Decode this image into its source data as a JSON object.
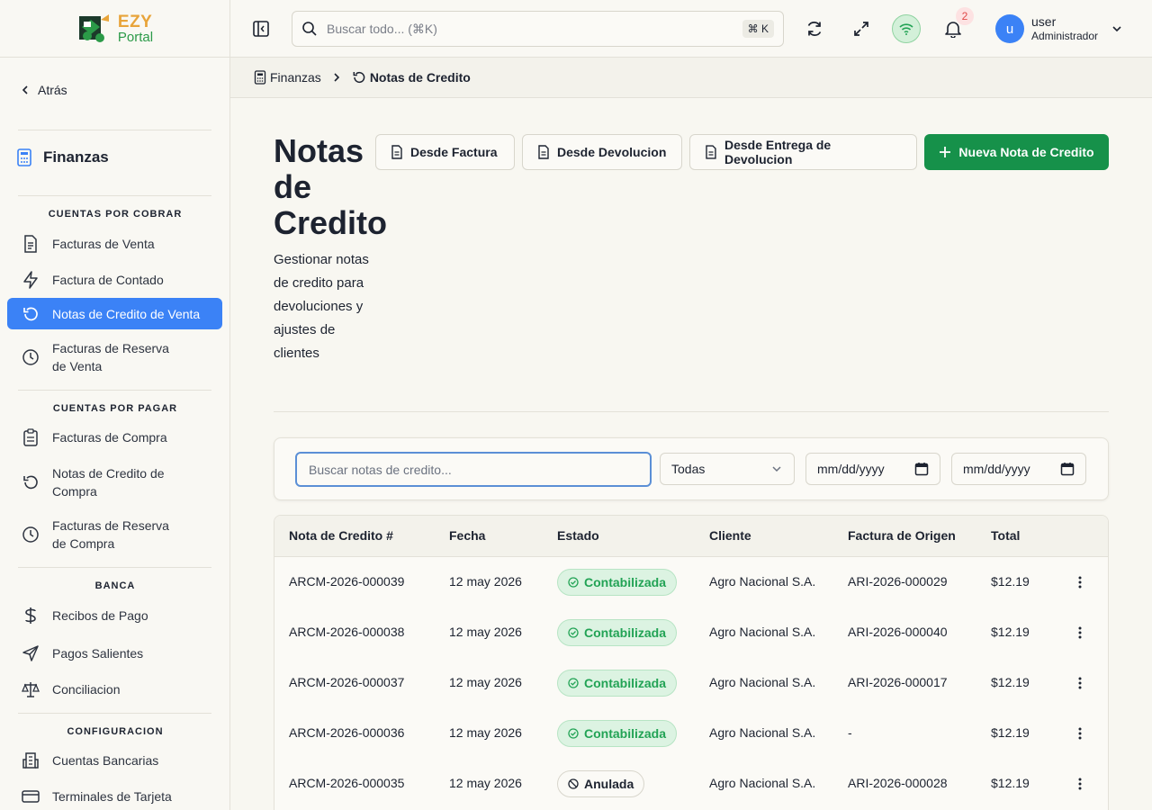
{
  "logo": {
    "line1": "EZY",
    "line2": "Portal"
  },
  "sidebar": {
    "back_label": "Atrás",
    "module_title": "Finanzas",
    "sections": [
      {
        "title": "CUENTAS POR COBRAR",
        "items": [
          "Facturas de Venta",
          "Factura de Contado",
          "Notas de Credito de Venta",
          "Facturas de Reserva de Venta"
        ]
      },
      {
        "title": "CUENTAS POR PAGAR",
        "items": [
          "Facturas de Compra",
          "Notas de Credito de Compra",
          "Facturas de Reserva de Compra"
        ]
      },
      {
        "title": "BANCA",
        "items": [
          "Recibos de Pago",
          "Pagos Salientes",
          "Conciliacion"
        ]
      },
      {
        "title": "CONFIGURACION",
        "items": [
          "Cuentas Bancarias",
          "Terminales de Tarjeta"
        ]
      }
    ],
    "item_labels": {
      "facturas_venta": "Facturas de Venta",
      "factura_contado": "Factura de Contado",
      "notas_credito_venta": "Notas de Credito de Venta",
      "facturas_reserva_venta": "Facturas de Reserva de Venta",
      "facturas_compra": "Facturas de Compra",
      "notas_credito_compra": "Notas de Credito de Compra",
      "facturas_reserva_compra": "Facturas de Reserva de Compra",
      "recibos_pago": "Recibos de Pago",
      "pagos_salientes": "Pagos Salientes",
      "conciliacion": "Conciliacion",
      "cuentas_bancarias": "Cuentas Bancarias",
      "terminales_tarjeta": "Terminales de Tarjeta"
    },
    "active_item": "Notas de Credito de Venta"
  },
  "topbar": {
    "search_placeholder": "Buscar todo... (⌘K)",
    "search_shortcut": "⌘ K",
    "notification_count": "2",
    "user_initial": "u",
    "user_name": "user",
    "user_role": "Administrador"
  },
  "breadcrumb": {
    "parent": "Finanzas",
    "current": "Notas de Credito"
  },
  "page": {
    "title": "Notas de Credito",
    "subtitle": "Gestionar notas de credito para devoluciones y ajustes de clientes",
    "actions": {
      "from_invoice": "Desde Factura",
      "from_return": "Desde Devolucion",
      "from_return_delivery": "Desde Entrega de Devolucion",
      "new": "Nueva Nota de Credito"
    }
  },
  "filters": {
    "search_placeholder": "Buscar notas de credito...",
    "status_value": "Todas",
    "date_from": "mm/dd/yyyy",
    "date_to": "mm/dd/yyyy"
  },
  "table": {
    "columns": {
      "number": "Nota de Credito #",
      "date": "Fecha",
      "status": "Estado",
      "customer": "Cliente",
      "source_invoice": "Factura de Origen",
      "total": "Total"
    },
    "rows": [
      {
        "number": "ARCM-2026-000039",
        "date": "12 may 2026",
        "status": "Contabilizada",
        "customer": "Agro Nacional S.A.",
        "source_invoice": "ARI-2026-000029",
        "total": "$12.19"
      },
      {
        "number": "ARCM-2026-000038",
        "date": "12 may 2026",
        "status": "Contabilizada",
        "customer": "Agro Nacional S.A.",
        "source_invoice": "ARI-2026-000040",
        "total": "$12.19"
      },
      {
        "number": "ARCM-2026-000037",
        "date": "12 may 2026",
        "status": "Contabilizada",
        "customer": "Agro Nacional S.A.",
        "source_invoice": "ARI-2026-000017",
        "total": "$12.19"
      },
      {
        "number": "ARCM-2026-000036",
        "date": "12 may 2026",
        "status": "Contabilizada",
        "customer": "Agro Nacional S.A.",
        "source_invoice": "-",
        "total": "$12.19"
      },
      {
        "number": "ARCM-2026-000035",
        "date": "12 may 2026",
        "status": "Anulada",
        "customer": "Agro Nacional S.A.",
        "source_invoice": "ARI-2026-000028",
        "total": "$12.19"
      }
    ]
  },
  "colors": {
    "accent": "#3b82f6",
    "primary": "#16914a",
    "posted": "#22a355",
    "notification": "#e04848"
  }
}
